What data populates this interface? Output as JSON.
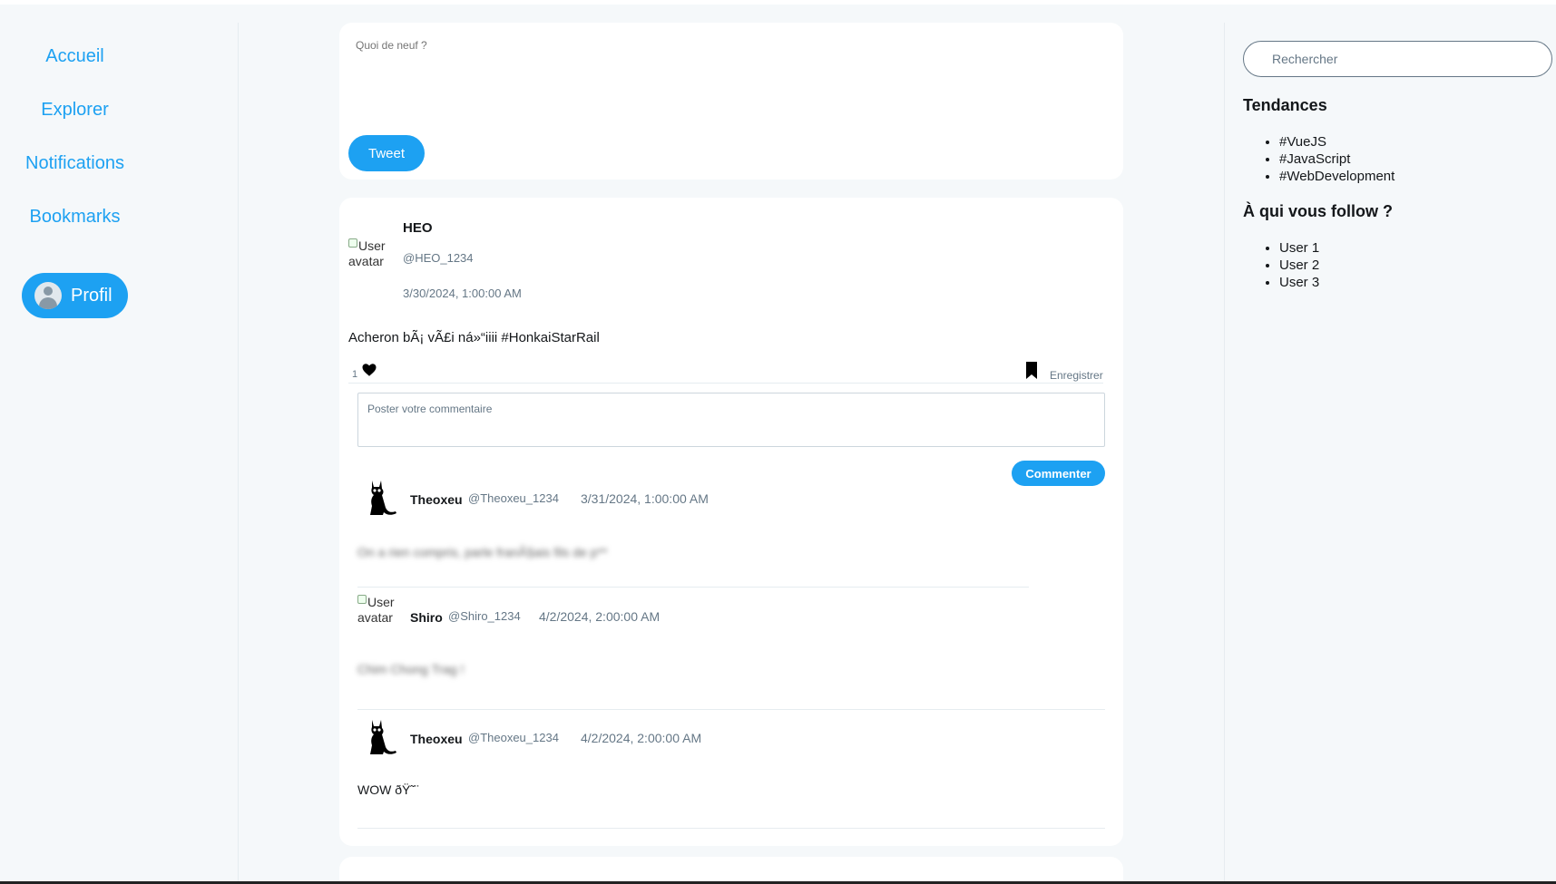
{
  "sidebar": {
    "items": [
      {
        "label": "Accueil"
      },
      {
        "label": "Explorer"
      },
      {
        "label": "Notifications"
      },
      {
        "label": "Bookmarks"
      }
    ],
    "profile_label": "Profil"
  },
  "compose": {
    "placeholder": "Quoi de neuf ?",
    "tweet_label": "Tweet"
  },
  "post": {
    "avatar_alt": "User avatar",
    "author": "HEO",
    "handle": "@HEO_1234",
    "date": "3/30/2024, 1:00:00 AM",
    "content": "Acheron bÃ¡ vÃ£i ná»“iiii #HonkaiStarRail",
    "like_count": "1",
    "save_label": "Enregistrer",
    "comment_placeholder": "Poster votre commentaire",
    "comment_button": "Commenter"
  },
  "comments": [
    {
      "name": "Theoxeu",
      "handle": "@Theoxeu_1234",
      "date": "3/31/2024, 1:00:00 AM",
      "text": "On a rien compris, parle franÃ§ais fils de p**",
      "blurred": true,
      "avatar": "cat-icon"
    },
    {
      "name": "Shiro",
      "handle": "@Shiro_1234",
      "date": "4/2/2024, 2:00:00 AM",
      "text": "Chim Chong Trag !",
      "blurred": true,
      "avatar": "broken",
      "avatar_alt": "User avatar"
    },
    {
      "name": "Theoxeu",
      "handle": "@Theoxeu_1234",
      "date": "4/2/2024, 2:00:00 AM",
      "text": "WOW ðŸ˜¨",
      "blurred": false,
      "avatar": "cat-icon"
    }
  ],
  "right": {
    "search_placeholder": "Rechercher",
    "trends_title": "Tendances",
    "trends": [
      "#VueJS",
      "#JavaScript",
      "#WebDevelopment"
    ],
    "follow_title": "À qui vous follow ?",
    "follow": [
      "User 1",
      "User 2",
      "User 3"
    ]
  },
  "colors": {
    "accent": "#1da1f2",
    "background": "#f5f8fa",
    "muted": "#657786"
  }
}
